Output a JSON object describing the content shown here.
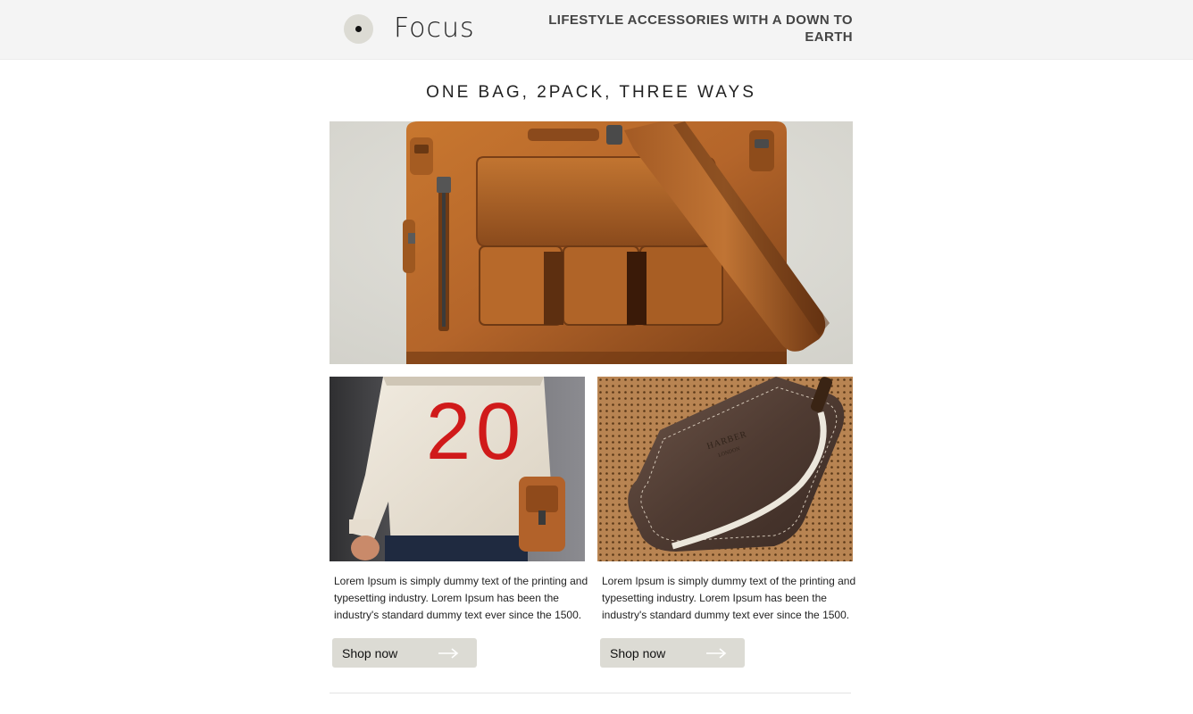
{
  "header": {
    "brand": "Focus",
    "tagline": "LIFESTYLE ACCESSORIES WITH A DOWN TO EARTH"
  },
  "main": {
    "headline": "ONE BAG, 2PACK, THREE WAYS",
    "cards": [
      {
        "text": "Lorem Ipsum is simply dummy text of the printing and typesetting industry. Lorem Ipsum has been the industry's standard dummy text ever since the 1500.",
        "button_label": "Shop now",
        "sweater_number": "20"
      },
      {
        "text": "Lorem Ipsum is simply dummy text of the printing and typesetting industry. Lorem Ipsum has been the industry's standard dummy text ever since the 1500.",
        "button_label": "Shop now"
      }
    ]
  },
  "colors": {
    "header_bg": "#f4f4f4",
    "button_bg": "#dcdbd4",
    "leather": "#b8692c",
    "sweater_number": "#d01a1a"
  },
  "icons": {
    "logo": "logo-dot-circle-icon",
    "button_arrow": "arrow-right-icon"
  }
}
